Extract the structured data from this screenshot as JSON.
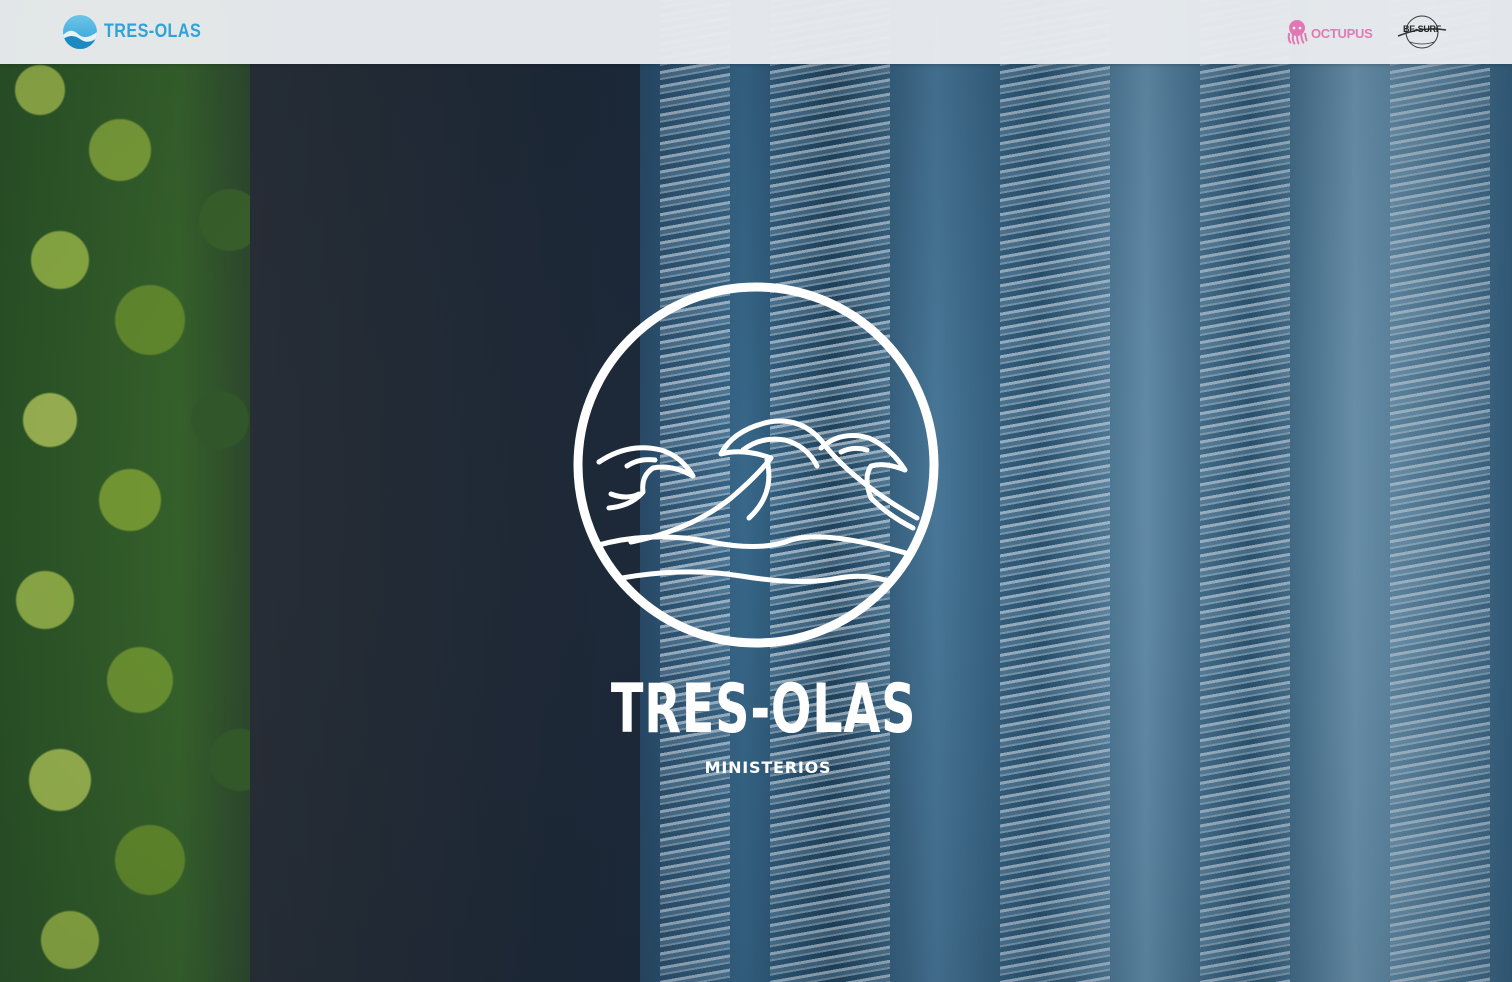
{
  "header": {
    "brand": {
      "name": "TRES-OLAS",
      "icon": "wave-circle-icon",
      "color": "#2fa6dd"
    },
    "partners": [
      {
        "name": "OCTUPUS",
        "icon": "octopus-icon",
        "color": "#e879b5"
      },
      {
        "name": "BE-SURF",
        "icon": "surf-circle-icon",
        "color": "#222222"
      }
    ]
  },
  "hero": {
    "title": "TRES-OLAS",
    "subtitle": "MINISTERIOS",
    "emblem_icon": "three-waves-circle-icon",
    "background": "aerial-beach-photo"
  }
}
